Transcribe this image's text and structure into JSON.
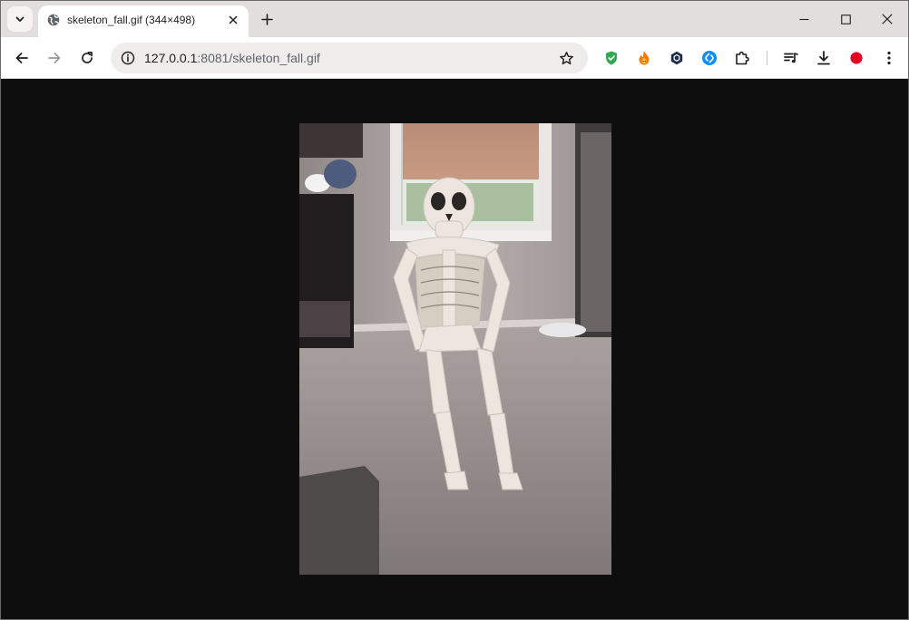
{
  "tab": {
    "title": "skeleton_fall.gif (344×498)",
    "favicon": "globe-icon"
  },
  "address_bar": {
    "host": "127.0.0.1",
    "path": ":8081/skeleton_fall.gif"
  },
  "toolbar_icons": [
    "back-arrow-icon",
    "forward-arrow-icon",
    "reload-icon",
    "site-info-icon",
    "bookmark-star-icon"
  ],
  "extensions": [
    {
      "name": "shield-check-extension-icon",
      "color": "#34a853"
    },
    {
      "name": "flame-extension-icon",
      "color": "#f57c00"
    },
    {
      "name": "hexagon-extension-icon",
      "color": "#1a2b4c"
    },
    {
      "name": "shazam-extension-icon",
      "color": "#0f8cf2"
    },
    {
      "name": "puzzle-extensions-icon",
      "color": "#1f1f1f"
    }
  ],
  "right_icons": [
    "media-queue-icon",
    "download-icon",
    "record-dot-icon",
    "kebab-menu-icon"
  ],
  "window_controls": [
    "minimize-icon",
    "maximize-icon",
    "close-window-icon"
  ],
  "image": {
    "description_alt": "skeleton_fall.gif",
    "background": "#0e0e0e"
  }
}
